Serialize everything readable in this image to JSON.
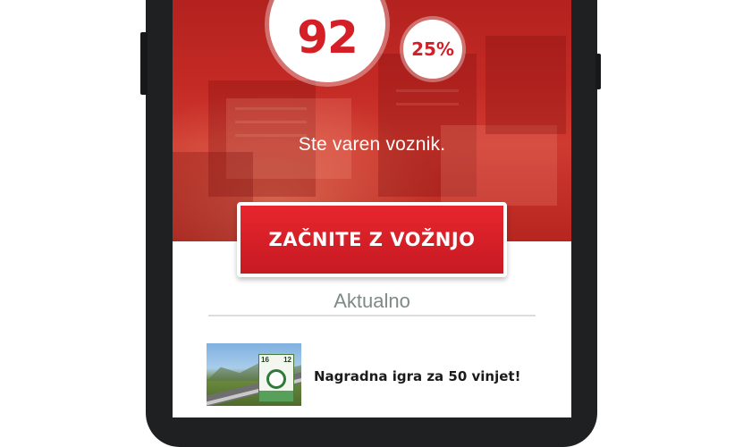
{
  "hero": {
    "score": "92",
    "percentile": "25%",
    "status": "Ste varen voznik."
  },
  "actions": {
    "start_label": "ZAČNITE Z VOŽNJO"
  },
  "news": {
    "section_title": "Aktualno",
    "items": [
      {
        "title": "Nagradna igra za 50 vinjet!",
        "thumbnail_labels": [
          "16",
          "12"
        ]
      }
    ]
  },
  "colors": {
    "brand_red": "#d41f27",
    "hero_red": "#c42a25",
    "section_grey": "#7e8a86"
  }
}
